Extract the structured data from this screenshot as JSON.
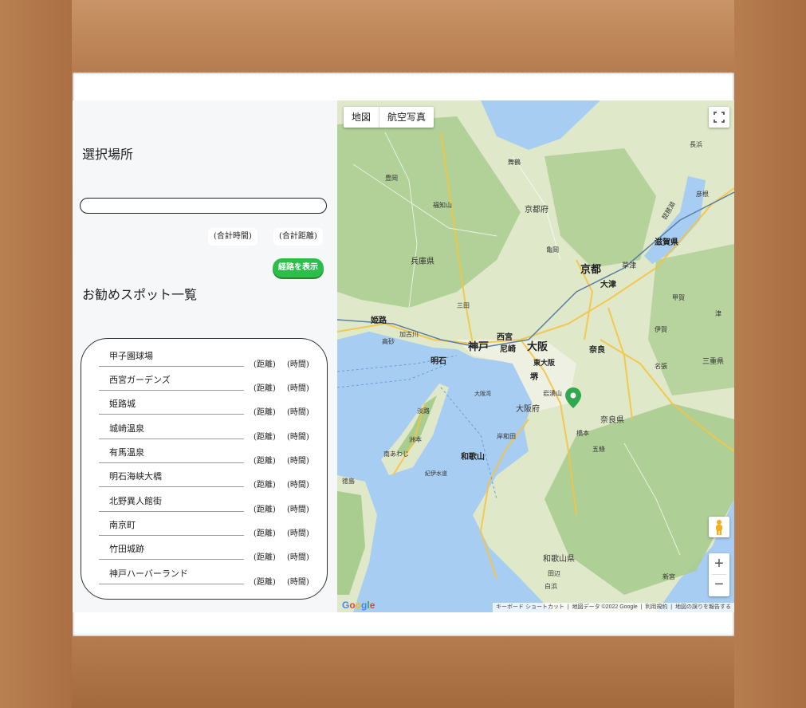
{
  "left": {
    "selected_title": "選択場所",
    "selected_value": "",
    "total_time": "(合計時間)",
    "total_distance": "(合計距離)",
    "route_button": "経路を表示",
    "spots_title": "お勧めスポット一覧",
    "spots": [
      {
        "name": "甲子園球場",
        "distance": "(距離)",
        "time": "(時間)"
      },
      {
        "name": "西宮ガーデンズ",
        "distance": "(距離)",
        "time": "(時間)"
      },
      {
        "name": "姫路城",
        "distance": "(距離)",
        "time": "(時間)"
      },
      {
        "name": "城崎温泉",
        "distance": "(距離)",
        "time": "(時間)"
      },
      {
        "name": "有馬温泉",
        "distance": "(距離)",
        "time": "(時間)"
      },
      {
        "name": "明石海峡大橋",
        "distance": "(距離)",
        "time": "(時間)"
      },
      {
        "name": "北野異人館街",
        "distance": "(距離)",
        "time": "(時間)"
      },
      {
        "name": "南京町",
        "distance": "(距離)",
        "time": "(時間)"
      },
      {
        "name": "竹田城跡",
        "distance": "(距離)",
        "time": "(時間)"
      },
      {
        "name": "神戸ハーバーランド",
        "distance": "(距離)",
        "time": "(時間)"
      }
    ]
  },
  "map": {
    "type_map": "地図",
    "type_satellite": "航空写真",
    "zoom_in": "+",
    "zoom_out": "−",
    "fullscreen_icon": "fullscreen-icon",
    "pegman_icon": "pegman-icon",
    "footer": {
      "shortcuts": "キーボード ショートカット",
      "map_data": "地図データ ©2022 Google",
      "terms": "利用規約",
      "report": "地図の誤りを報告する"
    },
    "logo": "Google",
    "labels": {
      "kyoto": "京都",
      "kobe": "神戸",
      "osaka": "大阪",
      "himeji": "姫路",
      "nishinomiya": "西宮",
      "amagasaki": "尼崎",
      "akashi": "明石",
      "nara": "奈良",
      "higashiosaka": "東大阪",
      "sakai": "堺",
      "wakayama": "和歌山",
      "otsu": "大津",
      "kusatsu": "草津",
      "hyogo_pref": "兵庫県",
      "kyoto_pref": "京都府",
      "osaka_pref": "大阪府",
      "nara_pref": "奈良県",
      "shiga_pref": "滋賀県",
      "wakayama_pref": "和歌山県",
      "mie_pref": "三重県",
      "awaji": "淡路",
      "sumoto": "洲本",
      "minamiawaji": "南あわじ",
      "tokushima": "徳島",
      "biwako": "琵琶湖",
      "fukuchiyama": "福知山",
      "maizuru": "舞鶴",
      "toyooka": "豊岡",
      "takasago": "高砂",
      "kakogawa": "加古川",
      "sanda": "三田",
      "kameoka": "亀岡",
      "tanabe": "田辺",
      "shingu": "新宮",
      "shirahama": "白浜",
      "iga": "伊賀",
      "nabari": "名張",
      "tsu": "津",
      "kishiwada": "岸和田",
      "hashimoto": "橋本",
      "gojo": "五條",
      "iwatesan": "岩湧山",
      "hikone": "彦根",
      "nagahama": "長浜",
      "osaka_bay": "大阪湾",
      "kii_channel": "紀伊水道",
      "koka": "甲賀"
    },
    "colors": {
      "land": "#dfe8c9",
      "forest": "#a9cc8f",
      "water": "#a8cdf2",
      "road": "#f5c542"
    }
  }
}
